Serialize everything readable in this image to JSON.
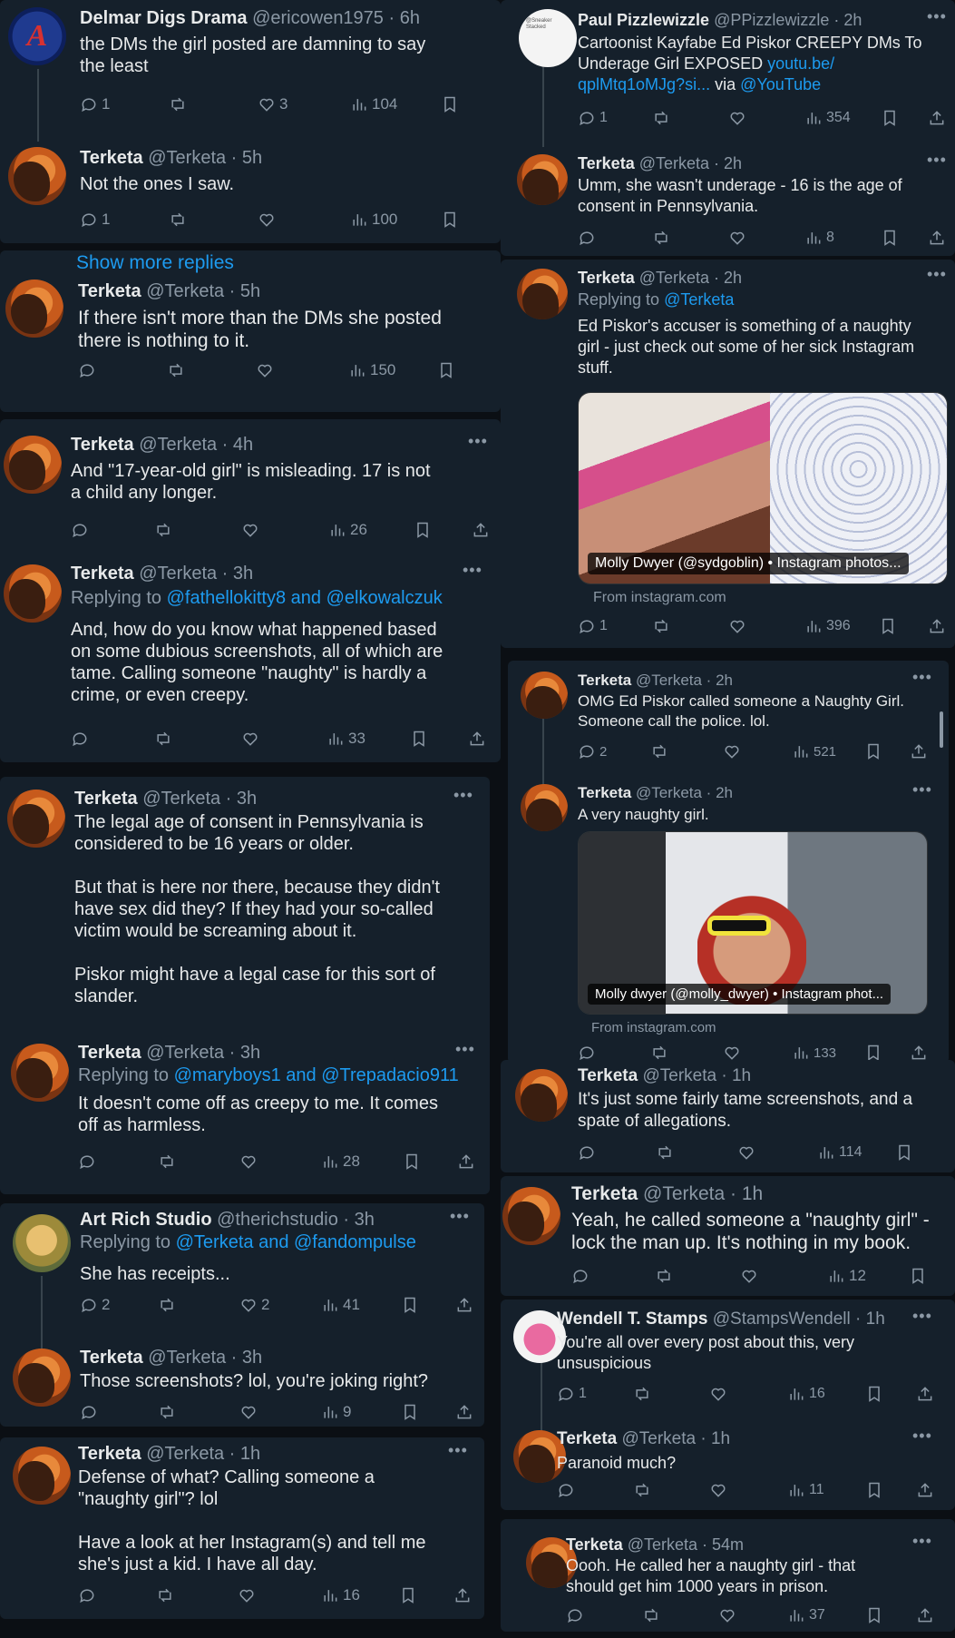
{
  "actions_icons": {
    "reply": "reply-icon",
    "retweet": "retweet-icon",
    "like": "heart-icon",
    "views": "views-icon",
    "bookmark": "bookmark-icon",
    "share": "share-icon"
  },
  "colors": {
    "background": "#15202b",
    "page": "#0b0f14",
    "link": "#1d9bf0",
    "muted": "#8b98a5"
  },
  "left": {
    "t1": {
      "name": "Delmar Digs Drama",
      "handle": "@ericowen1975 · 6h",
      "text": "the DMs the girl posted are damning to say\nthe least",
      "replies": "1",
      "likes": "3",
      "views": "104"
    },
    "t2": {
      "name": "Terketa",
      "handle": "@Terketa · 5h",
      "text": "Not the ones I saw.",
      "replies": "1",
      "views": "100"
    },
    "show_more": "Show more replies",
    "t3": {
      "name": "Terketa",
      "handle": "@Terketa · 5h",
      "text": "If there isn't more than the DMs she posted\nthere is nothing to it.",
      "views": "150"
    },
    "t4": {
      "name": "Terketa",
      "handle": "@Terketa · 4h",
      "text": "And \"17-year-old girl\" is misleading. 17 is not\na child any longer.",
      "views": "26"
    },
    "t5": {
      "name": "Terketa",
      "handle": "@Terketa · 3h",
      "replying_prefix": "Replying to",
      "replying_to": "@fathellokitty8 and @elkowalczuk",
      "text": "And, how do you know what happened based\non some dubious screenshots, all of which are\ntame. Calling someone \"naughty\" is hardly a\ncrime, or even creepy.",
      "views": "33"
    },
    "t6": {
      "name": "Terketa",
      "handle": "@Terketa · 3h",
      "text": "The legal age of consent in Pennsylvania is\nconsidered to be 16 years or older.\n\nBut that is here nor there, because they didn't\nhave sex did they? If they had your so-called\nvictim would be screaming about it.\n\nPiskor might have a legal case for this sort of\nslander."
    },
    "t7": {
      "name": "Terketa",
      "handle": "@Terketa · 3h",
      "replying_prefix": "Replying to",
      "replying_to": "@maryboys1 and @Trepadacio911",
      "text": "It doesn't come off as creepy to me. It comes\noff as harmless.",
      "views": "28"
    },
    "t8": {
      "name": "Art Rich Studio",
      "handle": "@therichstudio · 3h",
      "replying_prefix": "Replying to",
      "replying_to": "@Terketa and @fandompulse",
      "text": "She has receipts...",
      "replies": "2",
      "likes": "2",
      "views": "41"
    },
    "t9": {
      "name": "Terketa",
      "handle": "@Terketa · 3h",
      "text": "Those screenshots? lol, you're joking right?",
      "views": "9"
    },
    "t10": {
      "name": "Terketa",
      "handle": "@Terketa · 1h",
      "text": "Defense of what? Calling someone a\n\"naughty girl\"? lol\n\nHave a look at her Instagram(s) and tell me\nshe's just a kid. I have all day.",
      "views": "16"
    }
  },
  "right": {
    "r1": {
      "name": "Paul Pizzlewizzle",
      "handle": "@PPizzlewizzle · 2h",
      "text": "Cartoonist Kayfabe Ed Piskor CREEPY DMs To\nUnderage Girl EXPOSED ",
      "link": "youtu.be/\nqplMtq1oMJg?si...",
      "via": " via ",
      "via_link": "@YouTube",
      "replies": "1",
      "views": "354",
      "avatar_text": "@Sneaker Stacked"
    },
    "r2": {
      "name": "Terketa",
      "handle": "@Terketa · 2h",
      "text": "Umm, she wasn't underage - 16 is the age of\nconsent in Pennsylvania.",
      "views": "8"
    },
    "r3": {
      "name": "Terketa",
      "handle": "@Terketa · 2h",
      "replying_prefix": "Replying to",
      "replying_to": "@Terketa",
      "text": "Ed Piskor's accuser is something of a naughty\ngirl - just check out some of her sick Instagram\nstuff.",
      "card_caption": "Molly Dwyer (@sydgoblin) • Instagram photos...",
      "from": "From instagram.com",
      "replies": "1",
      "views": "396"
    },
    "r4": {
      "name": "Terketa",
      "handle": "@Terketa · 2h",
      "text": "OMG Ed Piskor called someone a Naughty Girl.\nSomeone call the police. lol.",
      "replies": "2",
      "views": "521"
    },
    "r5": {
      "name": "Terketa",
      "handle": "@Terketa · 2h",
      "text": "A very naughty girl.",
      "card_caption": "Molly dwyer (@molly_dwyer) • Instagram phot...",
      "from": "From instagram.com",
      "views": "133"
    },
    "r6": {
      "name": "Terketa",
      "handle": "@Terketa · 1h",
      "text": "It's just some fairly tame screenshots, and a\nspate of allegations.",
      "views": "114"
    },
    "r7": {
      "name": "Terketa",
      "handle": "@Terketa · 1h",
      "text": "Yeah, he called someone a \"naughty girl\" -\nlock the man up. It's nothing in my book.",
      "views": "12"
    },
    "r8": {
      "name": "Wendell T. Stamps",
      "handle": "@StampsWendell · 1h",
      "text": "You're all over every post about this, very\nunsuspicious",
      "replies": "1",
      "views": "16"
    },
    "r9": {
      "name": "Terketa",
      "handle": "@Terketa · 1h",
      "text": "Paranoid much?",
      "views": "11"
    },
    "r10": {
      "name": "Terketa",
      "handle": "@Terketa · 54m",
      "text": "Oooh. He called her a naughty girl - that\nshould get him 1000 years in prison.",
      "views": "37"
    }
  }
}
